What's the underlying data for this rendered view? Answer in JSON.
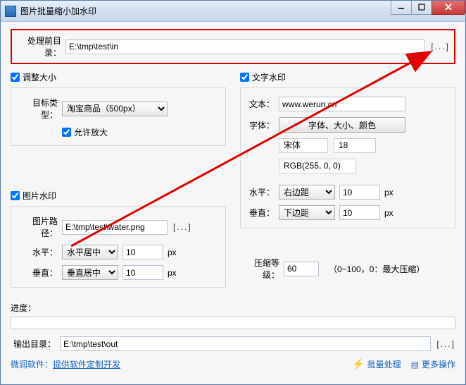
{
  "titlebar": {
    "title": "图片批量缩小加水印"
  },
  "input_dir": {
    "label": "处理前目录：",
    "value": "E:\\tmp\\test\\in",
    "browse": "[...]"
  },
  "resize": {
    "checkbox": "调整大小",
    "type_label": "目标类型：",
    "type_value": "淘宝商品（500px）",
    "allow_enlarge": "允许放大"
  },
  "img_wm": {
    "checkbox": "图片水印",
    "path_label": "图片路径：",
    "path_value": "E:\\tmp\\test\\water.png",
    "browse": "[...]",
    "h_label": "水平：",
    "h_sel": "水平居中",
    "h_val": "10",
    "h_unit": "px",
    "v_label": "垂直：",
    "v_sel": "垂直居中",
    "v_val": "10",
    "v_unit": "px"
  },
  "txt_wm": {
    "checkbox": "文字水印",
    "text_label": "文本：",
    "text_value": "www.werun.cn",
    "font_label": "字体：",
    "font_btn": "字体、大小、颜色",
    "font_name": "宋体",
    "font_size": "18",
    "font_color": "RGB(255, 0, 0)",
    "h_label": "水平：",
    "h_sel": "右边距",
    "h_val": "10",
    "h_unit": "px",
    "v_label": "垂直：",
    "v_sel": "下边距",
    "v_val": "10",
    "v_unit": "px"
  },
  "compress": {
    "label": "压缩等级：",
    "value": "60",
    "hint": "（0~100，0：最大压缩）"
  },
  "progress": {
    "label": "进度："
  },
  "output_dir": {
    "label": "输出目录：",
    "value": "E:\\tmp\\test\\out",
    "browse": "[...]"
  },
  "footer": {
    "brand": "微润软件：",
    "desc": "提供软件定制开发",
    "batch": "批量处理",
    "more": "更多操作"
  }
}
